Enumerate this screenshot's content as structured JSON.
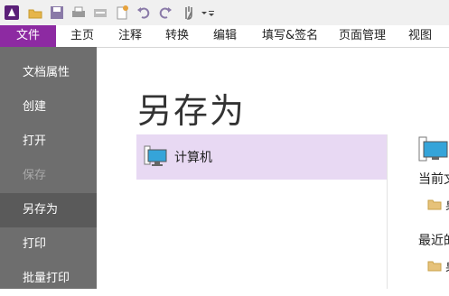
{
  "ribbon": {
    "tabs": [
      "文件",
      "主页",
      "注释",
      "转换",
      "编辑",
      "填写&签名",
      "页面管理",
      "视图"
    ]
  },
  "backstage": {
    "nav": [
      "文档属性",
      "创建",
      "打开",
      "保存",
      "另存为",
      "打印",
      "批量打印"
    ],
    "active": "另存为",
    "disabled": [
      "保存"
    ],
    "title": "另存为",
    "locations": [
      {
        "label": "计算机",
        "icon": "computer-icon"
      }
    ],
    "right_panel": {
      "current_label": "当前文",
      "current_folder_text": "桌",
      "recent_label": "最近的",
      "recent_folder_text": "桌"
    }
  },
  "colors": {
    "file_tab": "#8d2aa2",
    "nav_bg": "#6e6e6e",
    "nav_active": "#5a5a5a",
    "selected_location": "#e8d9f3"
  }
}
